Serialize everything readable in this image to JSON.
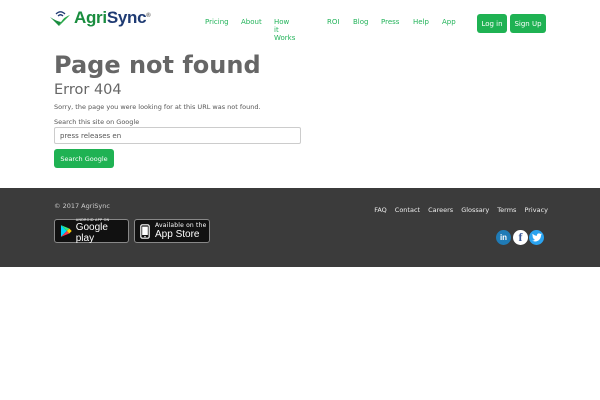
{
  "brand": {
    "name_part1": "Agri",
    "name_part2": "Sync",
    "reg": "®"
  },
  "nav": {
    "links": [
      "Pricing",
      "About",
      "How it Works",
      "ROI",
      "Blog",
      "Press",
      "Help",
      "App"
    ],
    "login": "Log in",
    "signup": "Sign Up"
  },
  "main": {
    "title": "Page not found",
    "subtitle": "Error 404",
    "message": "Sorry, the page you were looking for at this URL was not found.",
    "search_label": "Search this site on Google",
    "search_value": "press releases en",
    "search_button": "Search Google"
  },
  "footer": {
    "copyright": "© 2017 AgriSync",
    "google_play_small": "ANDROID APP ON",
    "google_play_big": "Google play",
    "app_store_small": "Available on the",
    "app_store_big": "App Store",
    "links": [
      "FAQ",
      "Contact",
      "Careers",
      "Glossary",
      "Terms",
      "Privacy"
    ],
    "social_icons": [
      "linkedin-icon",
      "facebook-icon",
      "twitter-icon"
    ]
  },
  "colors": {
    "accent": "#1fb253",
    "nav_link": "#23b35a",
    "footer_bg": "#3b3b3b",
    "brand_green": "#1a8d3f",
    "brand_blue": "#1f3b73",
    "linkedin": "#1f7bb6",
    "facebook": "#3b5998",
    "twitter": "#2aa3ef"
  }
}
